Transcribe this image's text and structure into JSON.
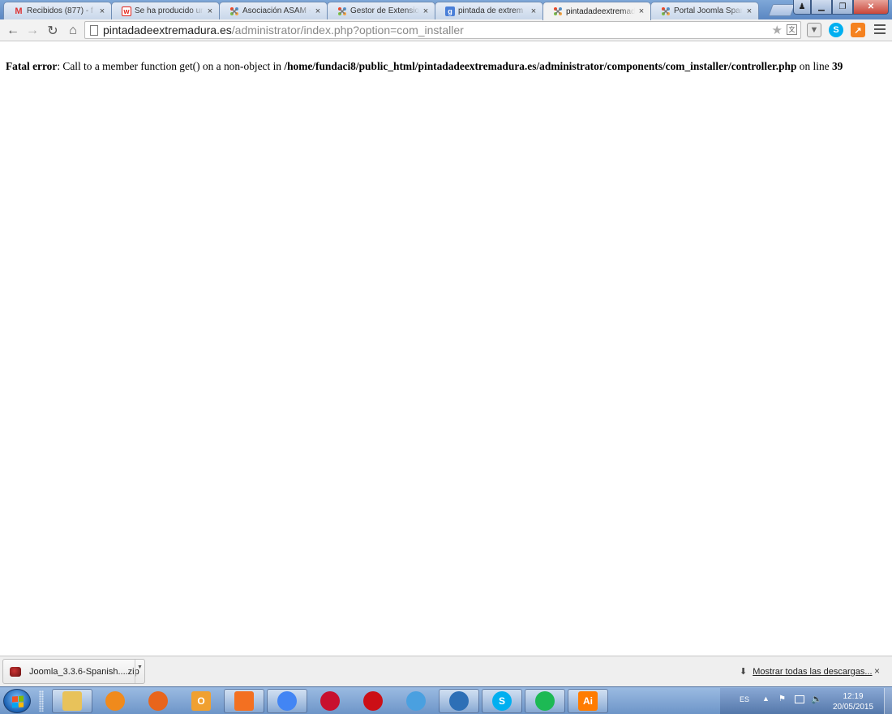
{
  "browser": {
    "tabs": [
      {
        "title": "Recibidos (877) - f",
        "favicon": "gmail-icon",
        "active": false
      },
      {
        "title": "Se ha producido un",
        "favicon": "w-icon",
        "active": false
      },
      {
        "title": "Asociación ASAM -",
        "favicon": "joomla-icon",
        "active": false
      },
      {
        "title": "Gestor de Extension",
        "favicon": "joomla-icon",
        "active": false
      },
      {
        "title": "pintada de extrem",
        "favicon": "google-icon",
        "active": false
      },
      {
        "title": "pintadadeextremad",
        "favicon": "joomla-icon",
        "active": true
      },
      {
        "title": "Portal Joomla Span",
        "favicon": "joomla-icon",
        "active": false
      }
    ],
    "tab_close_glyph": "×",
    "address": {
      "host": "pintadadeextremadura.es",
      "path": "/administrator/index.php?option=com_installer"
    }
  },
  "page": {
    "error_label": "Fatal error",
    "error_message": ": Call to a member function get() on a non-object in ",
    "error_file": "/home/fundaci8/public_html/pintadadeextremadura.es/administrator/components/com_installer/controller.php",
    "error_on_line": " on line ",
    "error_line_number": "39"
  },
  "downloads": {
    "item_name": "Joomla_3.3.6-Spanish....zip",
    "show_all": "Mostrar todas las descargas...",
    "close_glyph": "×"
  },
  "taskbar": {
    "apps": [
      {
        "name": "explorer",
        "label": "",
        "color": "#e8c25a"
      },
      {
        "name": "media-player",
        "label": "",
        "color": "#f08a1c"
      },
      {
        "name": "firefox",
        "label": "",
        "color": "#e8651c"
      },
      {
        "name": "outlook",
        "label": "O",
        "color": "#f0a030"
      },
      {
        "name": "xampp",
        "label": "",
        "color": "#f37021"
      },
      {
        "name": "chrome",
        "label": "",
        "color": "#4285f4"
      },
      {
        "name": "filezilla",
        "label": "",
        "color": "#c8102e"
      },
      {
        "name": "opera",
        "label": "",
        "color": "#cc0f16"
      },
      {
        "name": "safari",
        "label": "",
        "color": "#4aa0e0"
      },
      {
        "name": "user-app",
        "label": "",
        "color": "#2d6fb6"
      },
      {
        "name": "skype",
        "label": "S",
        "color": "#00aff0"
      },
      {
        "name": "spotify",
        "label": "",
        "color": "#1db954"
      },
      {
        "name": "illustrator",
        "label": "Ai",
        "color": "#ff7c00"
      }
    ],
    "tray": {
      "language": "ES",
      "time": "12:19",
      "date": "20/05/2015"
    }
  }
}
